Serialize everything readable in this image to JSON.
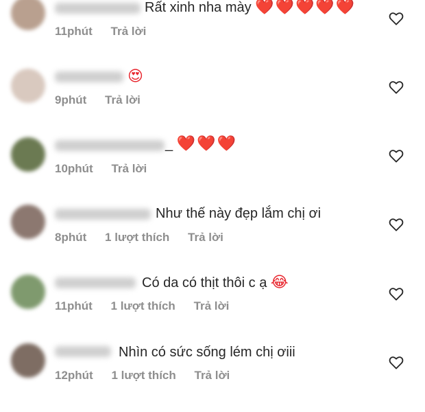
{
  "comments": [
    {
      "text": "Rất xinh nha mày",
      "emoji": "❤️❤️❤️❤️❤️",
      "time": "11phút",
      "likes": "",
      "reply": "Trả lời",
      "avatar_color": "#b9a08f"
    },
    {
      "text": "",
      "emoji": "😍",
      "time": "9phút",
      "likes": "",
      "reply": "Trả lời",
      "avatar_color": "#d9c9bf"
    },
    {
      "text": "_",
      "emoji": "❤️❤️❤️",
      "time": "10phút",
      "likes": "",
      "reply": "Trả lời",
      "avatar_color": "#6b7a52"
    },
    {
      "text": "Như thế này đẹp lắm chị ơi",
      "emoji": "",
      "time": "8phút",
      "likes": "1 lượt thích",
      "reply": "Trả lời",
      "avatar_color": "#8c7870"
    },
    {
      "text": "Có da có thịt thôi c ạ",
      "emoji": "😂",
      "time": "11phút",
      "likes": "1 lượt thích",
      "reply": "Trả lời",
      "avatar_color": "#7f9a6e"
    },
    {
      "text": "Nhìn có sức sống lém chị ơiii",
      "emoji": "",
      "time": "12phút",
      "likes": "1 lượt thích",
      "reply": "Trả lời",
      "avatar_color": "#7e6d63"
    }
  ]
}
